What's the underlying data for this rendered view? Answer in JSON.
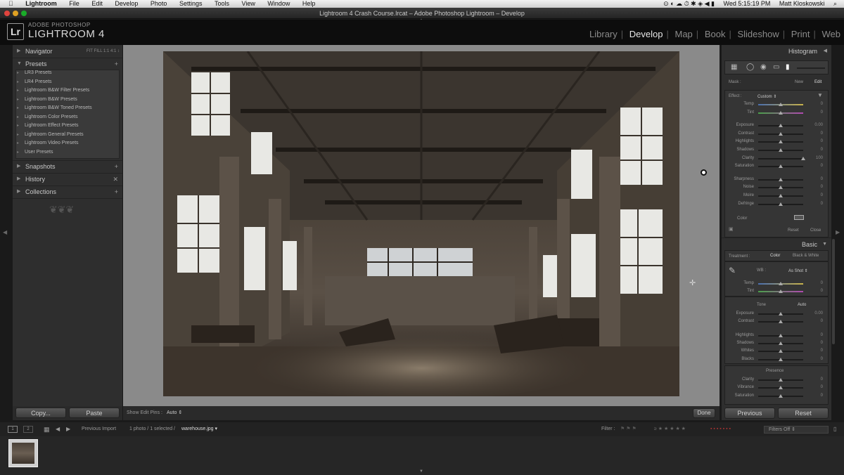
{
  "os_menu": {
    "apple": "",
    "items": [
      "Lightroom",
      "File",
      "Edit",
      "Develop",
      "Photo",
      "Settings",
      "Tools",
      "View",
      "Window",
      "Help"
    ],
    "clock": "Wed 5:15:19 PM",
    "user": "Matt Kloskowski"
  },
  "window": {
    "title": "Lightroom 4 Crash Course.lrcat – Adobe Photoshop Lightroom – Develop"
  },
  "identity": {
    "logo": "Lr",
    "line1": "ADOBE PHOTOSHOP",
    "line2": "LIGHTROOM 4"
  },
  "modules": [
    "Library",
    "Develop",
    "Map",
    "Book",
    "Slideshow",
    "Print",
    "Web"
  ],
  "active_module": "Develop",
  "left_panel": {
    "navigator": "Navigator",
    "nav_options": "FIT  FILL  1:1  4:1 ↕",
    "presets": "Presets",
    "preset_folders": [
      "LR3 Presets",
      "LR4 Presets",
      "Lightroom B&W Filter Presets",
      "Lightroom B&W Presets",
      "Lightroom B&W Toned Presets",
      "Lightroom Color Presets",
      "Lightroom Effect Presets",
      "Lightroom General Presets",
      "Lightroom Video Presets",
      "User Presets"
    ],
    "snapshots": "Snapshots",
    "history": "History",
    "collections": "Collections",
    "copy": "Copy...",
    "paste": "Paste"
  },
  "toolbar": {
    "show_edit_pins": "Show Edit Pins :",
    "pins_value": "Auto",
    "done": "Done"
  },
  "right_panel": {
    "histogram": "Histogram",
    "mask_label": "Mask :",
    "mask_new": "New",
    "mask_edit": "Edit",
    "effect_label": "Effect :",
    "effect_value": "Custom",
    "brush_sliders": [
      {
        "label": "Temp",
        "value": "0",
        "pos": 0.5
      },
      {
        "label": "Tint",
        "value": "0",
        "pos": 0.5
      },
      {
        "label": "Exposure",
        "value": "0.00",
        "pos": 0.5
      },
      {
        "label": "Contrast",
        "value": "0",
        "pos": 0.5
      },
      {
        "label": "Highlights",
        "value": "0",
        "pos": 0.5
      },
      {
        "label": "Shadows",
        "value": "0",
        "pos": 0.5
      },
      {
        "label": "Clarity",
        "value": "100",
        "pos": 1.0
      },
      {
        "label": "Saturation",
        "value": "0",
        "pos": 0.5
      },
      {
        "label": "Sharpness",
        "value": "0",
        "pos": 0.5
      },
      {
        "label": "Noise",
        "value": "0",
        "pos": 0.5
      },
      {
        "label": "Moire",
        "value": "0",
        "pos": 0.5
      },
      {
        "label": "Defringe",
        "value": "0",
        "pos": 0.5
      }
    ],
    "color_label": "Color",
    "reset": "Reset",
    "close": "Close",
    "basic": "Basic",
    "treatment_label": "Treatment :",
    "treatment_color": "Color",
    "treatment_bw": "Black & White",
    "wb_label": "WB :",
    "wb_value": "As Shot",
    "wb_sliders": [
      {
        "label": "Temp",
        "value": "0",
        "pos": 0.5
      },
      {
        "label": "Tint",
        "value": "0",
        "pos": 0.5
      }
    ],
    "tone_label": "Tone",
    "tone_auto": "Auto",
    "tone_sliders": [
      {
        "label": "Exposure",
        "value": "0.00",
        "pos": 0.5
      },
      {
        "label": "Contrast",
        "value": "0",
        "pos": 0.5
      },
      {
        "label": "Highlights",
        "value": "0",
        "pos": 0.5
      },
      {
        "label": "Shadows",
        "value": "0",
        "pos": 0.5
      },
      {
        "label": "Whites",
        "value": "0",
        "pos": 0.5
      },
      {
        "label": "Blacks",
        "value": "0",
        "pos": 0.5
      }
    ],
    "presence_label": "Presence",
    "presence_sliders": [
      {
        "label": "Clarity",
        "value": "0",
        "pos": 0.5
      },
      {
        "label": "Vibrance",
        "value": "0",
        "pos": 0.5
      },
      {
        "label": "Saturation",
        "value": "0",
        "pos": 0.5
      }
    ],
    "previous": "Previous",
    "reset_btn": "Reset"
  },
  "filmstrip": {
    "source": "Previous Import",
    "count": "1 photo / 1 selected /",
    "filename": "warehouse.jpg",
    "filter_label": "Filter :",
    "filters_off": "Filters Off"
  }
}
